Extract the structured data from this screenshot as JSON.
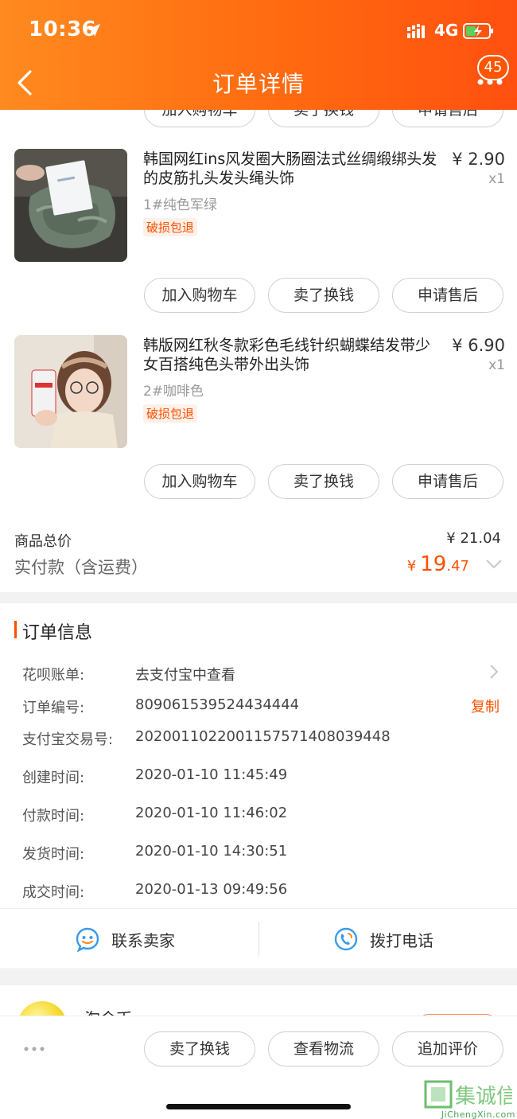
{
  "status_bar": {
    "time": "10:36",
    "network": "4G"
  },
  "header": {
    "title": "订单详情",
    "badge": "45"
  },
  "top_partial_buttons": [
    "加入购物车",
    "卖了换钱",
    "申请售后"
  ],
  "products": [
    {
      "title": "韩国网红ins风发圈大肠圈法式丝绸缎绑头发的皮筋扎头发头绳头饰",
      "price": "¥ 2.90",
      "qty": "x1",
      "spec": "1#纯色军绿",
      "tag": "破损包退",
      "buttons": [
        "加入购物车",
        "卖了换钱",
        "申请售后"
      ]
    },
    {
      "title": "韩版网红秋冬款彩色毛线针织蝴蝶结发带少女百搭纯色头带外出头饰",
      "price": "¥ 6.90",
      "qty": "x1",
      "spec": "2#咖啡色",
      "tag": "破损包退",
      "buttons": [
        "加入购物车",
        "卖了换钱",
        "申请售后"
      ]
    }
  ],
  "summary": {
    "total_label": "商品总价",
    "total_value": "¥ 21.04",
    "paid_label": "实付款（含运费）",
    "paid_symbol": "¥",
    "paid_int": "19",
    "paid_dec": ".47"
  },
  "order_info": {
    "title": "订单信息",
    "rows": [
      {
        "label": "花呗账单:",
        "value": "去支付宝中查看"
      },
      {
        "label": "订单编号:",
        "value": "809061539524434444"
      },
      {
        "label": "支付宝交易号:",
        "value": "2020011022001157571408039448"
      },
      {
        "label": "创建时间:",
        "value": "2020-01-10 11:45:49"
      },
      {
        "label": "付款时间:",
        "value": "2020-01-10 11:46:02"
      },
      {
        "label": "发货时间:",
        "value": "2020-01-10 14:30:51"
      },
      {
        "label": "成交时间:",
        "value": "2020-01-13 09:49:56"
      }
    ],
    "copy_label": "复制"
  },
  "contact": {
    "seller": "联系卖家",
    "phone": "拨打电话"
  },
  "promo": {
    "title": "淘金币"
  },
  "bottom_bar": {
    "buttons": [
      "卖了换钱",
      "查看物流",
      "追加评价"
    ]
  },
  "watermark": {
    "text": "集诚信",
    "sub": "JiChengXin.com"
  },
  "colors": {
    "accent": "#ff5000",
    "header_start": "#ff8a1f",
    "header_end": "#ff5010"
  }
}
